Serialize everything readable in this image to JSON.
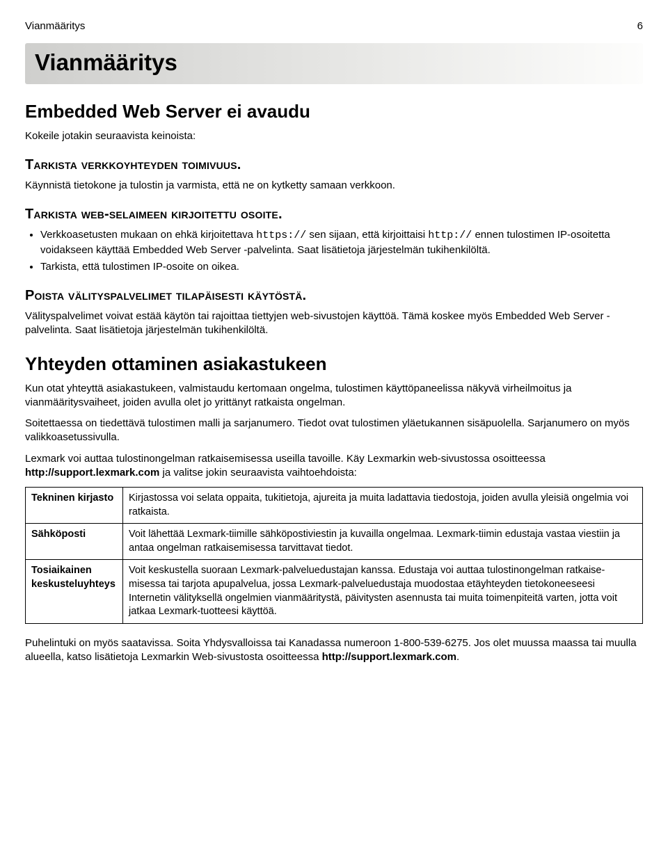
{
  "header": {
    "left": "Vianmääritys",
    "right": "6"
  },
  "titlebar": "Vianmääritys",
  "h2_ews": "Embedded Web Server ei avaudu",
  "intro": "Kokeile jotakin seuraavista keinoista:",
  "sec1": {
    "heading": "Tarkista verkkoyhteyden toimivuus.",
    "para": "Käynnistä tietokone ja tulostin ja varmista, että ne on kytketty samaan verkkoon."
  },
  "sec2": {
    "heading": "Tarkista web-selaimeen kirjoitettu osoite.",
    "bullet1_a": "Verkkoasetusten mukaan on ehkä kirjoitettava ",
    "bullet1_https": "https://",
    "bullet1_b": " sen sijaan, että kirjoittaisi ",
    "bullet1_http": "http://",
    "bullet1_c": " ennen tulostimen IP-osoitetta voidakseen käyttää Embedded Web Server -palvelinta. Saat lisätietoja järjestelmän tukihenkilöltä.",
    "bullet2": "Tarkista, että tulostimen IP-osoite on oikea."
  },
  "sec3": {
    "heading": "Poista välityspalvelimet tilapäisesti käytöstä.",
    "para": "Välityspalvelimet voivat estää käytön tai rajoittaa tiettyjen web-sivustojen käyttöä. Tämä koskee myös Embedded Web Server -palvelinta. Saat lisätietoja järjestelmän tukihenkilöltä."
  },
  "h2_contact": "Yhteyden ottaminen asiakastukeen",
  "contact_p1": "Kun otat yhteyttä asiakastukeen, valmistaudu kertomaan ongelma, tulostimen käyttöpaneelissa näkyvä virheilmoitus ja vianmääritysvaiheet, joiden avulla olet jo yrittänyt ratkaista ongelman.",
  "contact_p2": "Soitettaessa on tiedettävä tulostimen malli ja sarjanumero. Tiedot ovat tulostimen yläetukannen sisäpuolella. Sarjanumero on myös valikkoasetussivulla.",
  "contact_p3a": "Lexmark voi auttaa tulostinongelman ratkaisemisessa useilla tavoille. Käy Lexmarkin web-sivustossa osoitteessa ",
  "contact_p3_link": "http://support.lexmark.com",
  "contact_p3b": " ja valitse jokin seuraavista vaihtoehdoista:",
  "table": {
    "r1l": "Tekninen kirjasto",
    "r1r": "Kirjastossa voi selata oppaita, tukitietoja, ajureita ja muita ladattavia tiedostoja, joiden avulla yleisiä ongelmia voi ratkaista.",
    "r2l": "Sähköposti",
    "r2r": "Voit lähettää Lexmark-tiimille sähköpostiviestin ja kuvailla ongelmaa. Lexmark-tiimin edustaja vastaa viestiin ja antaa ongelman ratkaisemisessa tarvittavat tiedot.",
    "r3l": "Tosiaikainen keskusteluyhteys",
    "r3r": "Voit keskustella suoraan Lexmark-palveluedustajan kanssa. Edustaja voi auttaa tulostinongelman ratkaise­misessa tai tarjota apupalvelua, jossa Lexmark-palveluedustaja muodostaa etäyhteyden tietokoneeseesi Internetin välityksellä ongelmien vianmääritystä, päivitysten asennusta tai muita toimenpiteitä varten, jotta voit jatkaa Lexmark-tuotteesi käyttöä."
  },
  "footer_a": "Puhelintuki on myös saatavissa. Soita Yhdysvalloissa tai Kanadassa numeroon 1-800-539-6275. Jos olet muussa maassa tai muulla alueella, katso lisätietoja Lexmarkin Web-sivustosta osoitteessa ",
  "footer_link": "http://support.lexmark.com",
  "footer_b": "."
}
